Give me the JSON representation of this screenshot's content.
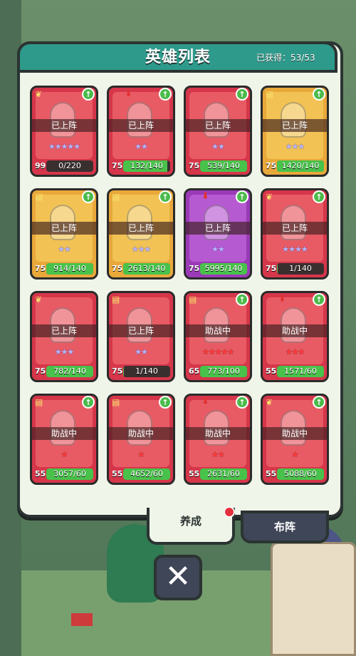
{
  "header": {
    "title": "英雄列表",
    "collected": "已获得：53/53"
  },
  "tabs": {
    "train": "养成",
    "formation": "布阵"
  },
  "close": {
    "label": "✕"
  },
  "colors": {
    "header": "#2e9a8b",
    "panel": "#f0f5e9",
    "progress": "#48c24a"
  },
  "heroes": [
    {
      "color": "red",
      "role": "leaf",
      "up": true,
      "down": false,
      "status": "已上阵",
      "stars": "★★★★★",
      "star_type": "blue",
      "level": "99",
      "progress_text": "0/220",
      "progress": 0.0
    },
    {
      "color": "red",
      "role": "none",
      "up": true,
      "down": true,
      "status": "已上阵",
      "stars": "★★",
      "star_type": "blue",
      "level": "75",
      "progress_text": "132/140",
      "progress": 0.94
    },
    {
      "color": "red",
      "role": "none",
      "up": true,
      "down": false,
      "status": "已上阵",
      "stars": "★★",
      "star_type": "blue",
      "level": "75",
      "progress_text": "539/140",
      "progress": 1.0
    },
    {
      "color": "gold",
      "role": "book",
      "up": true,
      "down": false,
      "status": "已上阵",
      "stars": "★★★",
      "star_type": "blue",
      "level": "75",
      "progress_text": "1420/140",
      "progress": 1.0
    },
    {
      "color": "gold",
      "role": "book",
      "up": true,
      "down": false,
      "status": "已上阵",
      "stars": "★★",
      "star_type": "blue",
      "level": "75",
      "progress_text": "914/140",
      "progress": 1.0
    },
    {
      "color": "gold",
      "role": "book",
      "up": true,
      "down": false,
      "status": "已上阵",
      "stars": "★★★",
      "star_type": "blue",
      "level": "75",
      "progress_text": "2613/140",
      "progress": 1.0
    },
    {
      "color": "purple",
      "role": "none",
      "up": true,
      "down": true,
      "status": "已上阵",
      "stars": "★★",
      "star_type": "blue",
      "level": "75",
      "progress_text": "5995/140",
      "progress": 1.0
    },
    {
      "color": "red",
      "role": "leaf",
      "up": true,
      "down": false,
      "status": "已上阵",
      "stars": "★★★★",
      "star_type": "blue",
      "level": "75",
      "progress_text": "1/140",
      "progress": 0.01
    },
    {
      "color": "red",
      "role": "leaf",
      "up": false,
      "down": false,
      "status": "已上阵",
      "stars": "★★★",
      "star_type": "blue",
      "level": "75",
      "progress_text": "782/140",
      "progress": 1.0
    },
    {
      "color": "red",
      "role": "book",
      "up": false,
      "down": false,
      "status": "已上阵",
      "stars": "★★",
      "star_type": "blue",
      "level": "75",
      "progress_text": "1/140",
      "progress": 0.01
    },
    {
      "color": "red",
      "role": "book",
      "up": true,
      "down": false,
      "status": "助战中",
      "stars": "★★★★★",
      "star_type": "red",
      "level": "65",
      "progress_text": "773/100",
      "progress": 1.0
    },
    {
      "color": "red",
      "role": "none",
      "up": true,
      "down": true,
      "status": "助战中",
      "stars": "★★★",
      "star_type": "red",
      "level": "55",
      "progress_text": "1571/60",
      "progress": 1.0
    },
    {
      "color": "red",
      "role": "book",
      "up": true,
      "down": false,
      "status": "助战中",
      "stars": "★",
      "star_type": "red",
      "level": "55",
      "progress_text": "3057/60",
      "progress": 1.0
    },
    {
      "color": "red",
      "role": "book",
      "up": true,
      "down": false,
      "status": "助战中",
      "stars": "★",
      "star_type": "red",
      "level": "55",
      "progress_text": "4652/60",
      "progress": 1.0
    },
    {
      "color": "red",
      "role": "none",
      "up": true,
      "down": true,
      "status": "助战中",
      "stars": "★★",
      "star_type": "red",
      "level": "55",
      "progress_text": "2631/60",
      "progress": 1.0
    },
    {
      "color": "red",
      "role": "leaf",
      "up": true,
      "down": false,
      "status": "助战中",
      "stars": "★",
      "star_type": "red",
      "level": "55",
      "progress_text": "5088/60",
      "progress": 1.0
    }
  ]
}
